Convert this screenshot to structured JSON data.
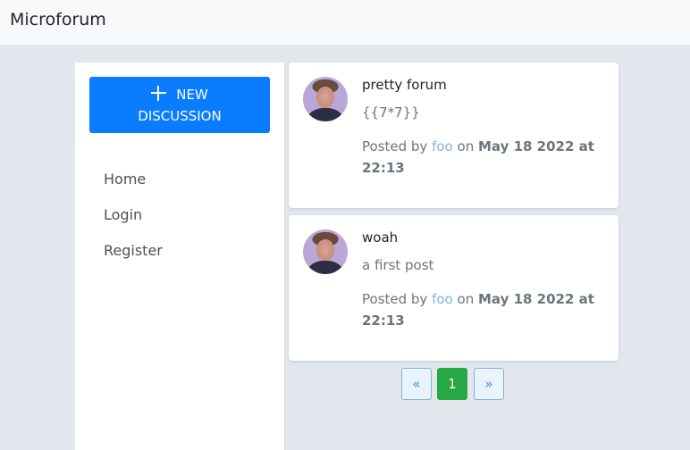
{
  "navbar": {
    "brand": "Microforum"
  },
  "sidebar": {
    "new_button": {
      "icon": "plus-icon",
      "line1": "NEW",
      "line2": "DISCUSSION"
    },
    "links": [
      {
        "label": "Home"
      },
      {
        "label": "Login"
      },
      {
        "label": "Register"
      }
    ]
  },
  "posts": [
    {
      "title": "pretty forum",
      "body": "{{7*7}}",
      "meta_prefix": "Posted by",
      "author": "foo",
      "meta_on": "on",
      "date": "May 18 2022 at 22:13"
    },
    {
      "title": "woah",
      "body": "a first post",
      "meta_prefix": "Posted by",
      "author": "foo",
      "meta_on": "on",
      "date": "May 18 2022 at 22:13"
    }
  ],
  "pagination": {
    "prev": "«",
    "current": "1",
    "next": "»"
  },
  "colors": {
    "primary": "#0a7cff",
    "success": "#28a745",
    "link": "#7fb2e0",
    "background": "#e2e7ee"
  }
}
